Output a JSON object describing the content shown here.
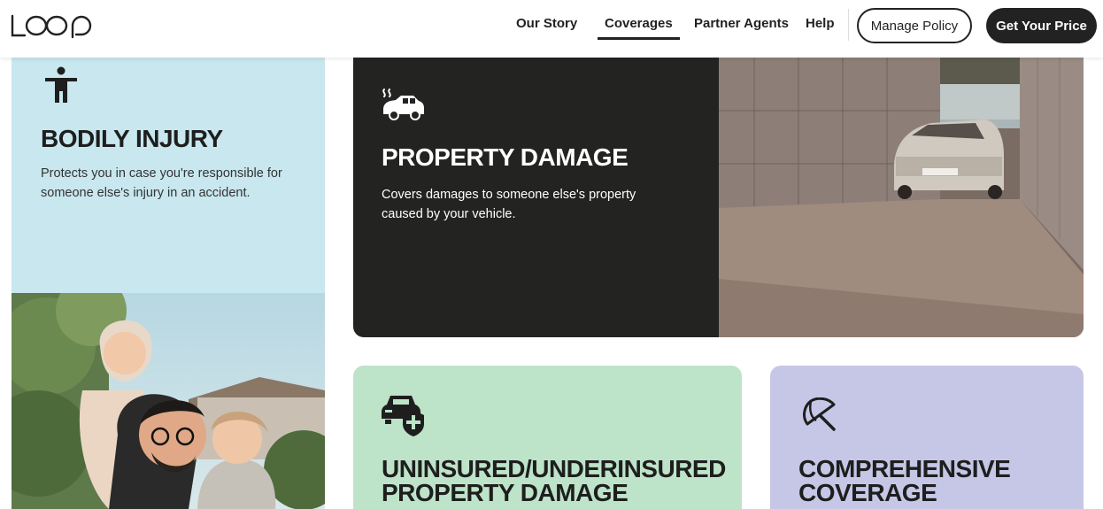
{
  "header": {
    "logo_text": "LOOP",
    "nav": [
      {
        "label": "Our Story"
      },
      {
        "label": "Coverages"
      },
      {
        "label": "Partner Agents"
      },
      {
        "label": "Help"
      }
    ],
    "manage_policy": "Manage Policy",
    "get_price": "Get Your Price"
  },
  "cards": {
    "bodily": {
      "icon": "person-icon",
      "title": "BODILY INJURY",
      "body": "Protects you in case you're responsible for someone else's injury in an accident."
    },
    "property": {
      "icon": "car-smoke-icon",
      "title": "PROPERTY DAMAGE",
      "body": "Covers damages to someone else's property caused by your vehicle."
    },
    "uninsured": {
      "icon": "car-shield-plus-icon",
      "title_line1": "UNINSURED/UNDERINSURED",
      "title_line2": "PROPERTY DAMAGE"
    },
    "comprehensive": {
      "icon": "umbrella-icon",
      "title_line1": "COMPREHENSIVE",
      "title_line2": "COVERAGE"
    }
  },
  "colors": {
    "bodily_bg": "#c8e7ef",
    "property_bg": "#232321",
    "uninsured_bg": "#bde3c8",
    "comprehensive_bg": "#c6c6e6",
    "ink": "#222222"
  }
}
